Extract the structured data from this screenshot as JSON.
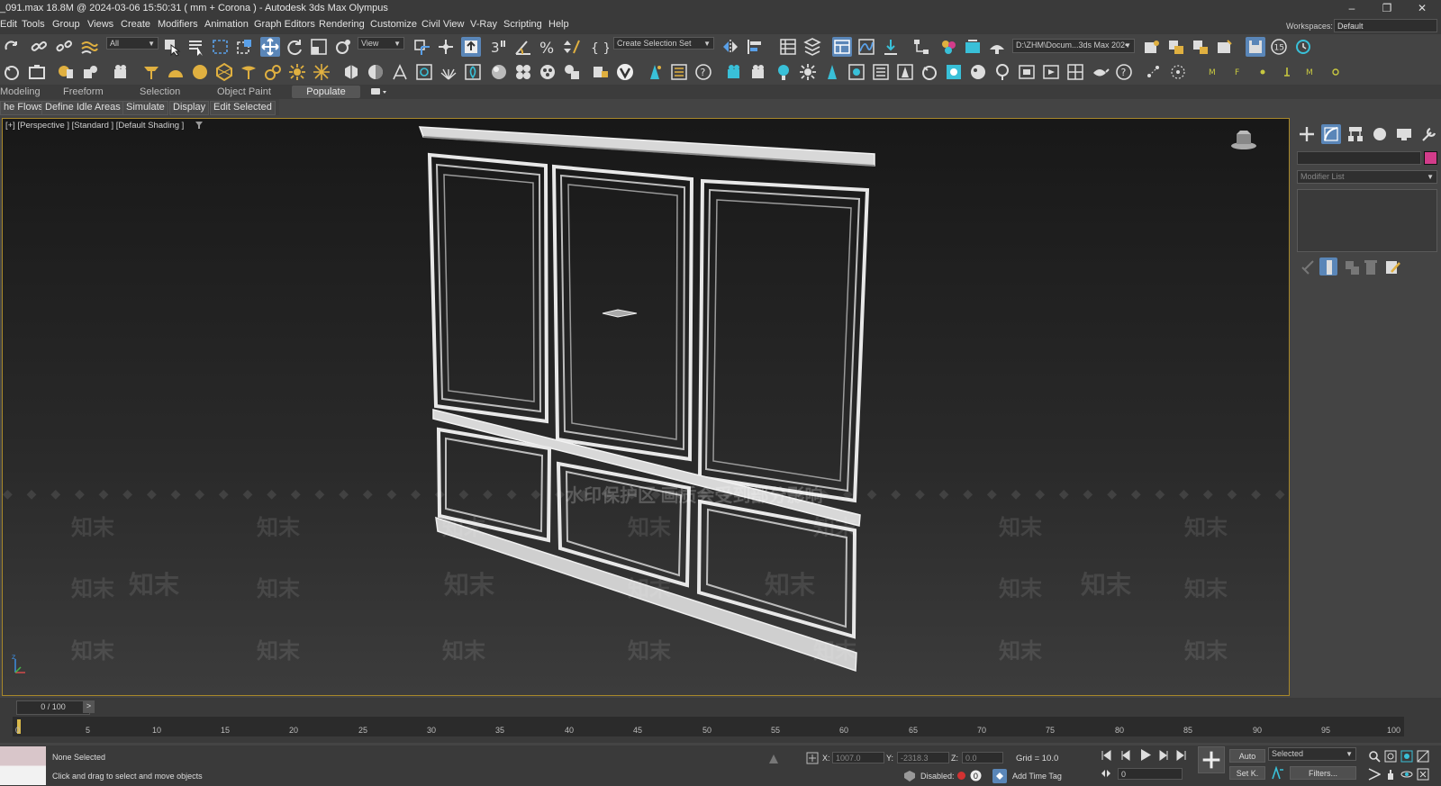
{
  "title": "_091.max  18.8M @ 2024-03-06 15:50:31  ( mm + Corona ) - Autodesk 3ds Max Olympus",
  "menu": [
    "Edit",
    "Tools",
    "Group",
    "Views",
    "Create",
    "Modifiers",
    "Animation",
    "Graph Editors",
    "Rendering",
    "Customize",
    "Civil View",
    "V-Ray",
    "Scripting",
    "Help"
  ],
  "workspace": {
    "label": "Workspaces:",
    "value": "Default"
  },
  "toolbar": {
    "filter": "All",
    "ref_coord": "View",
    "selection_set": "Create Selection Set",
    "project_path": "D:\\ZHM\\Docum...3ds Max 202•"
  },
  "ribbon": {
    "tabs": [
      "Modeling",
      "Freeform",
      "Selection",
      "Object Paint",
      "Populate"
    ],
    "commands": [
      "he Flows",
      "Define Idle Areas",
      "Simulate",
      "Display",
      "Edit Selected"
    ]
  },
  "viewport": {
    "label": "[+] [Perspective ] [Standard ] [Default Shading ]"
  },
  "cmd_panel": {
    "modifier_list": "Modifier List",
    "object_color": "#d23c8a"
  },
  "timeline": {
    "slider": "0 / 100",
    "next": ">",
    "ticks": [
      "0",
      "5",
      "10",
      "15",
      "20",
      "25",
      "30",
      "35",
      "40",
      "45",
      "50",
      "55",
      "60",
      "65",
      "70",
      "75",
      "80",
      "85",
      "90",
      "95",
      "100"
    ]
  },
  "status": {
    "selected": "None Selected",
    "prompt": "Click and drag to select and move objects",
    "x_label": "X:",
    "x_value": "1007.0",
    "y_label": "Y:",
    "y_value": "-2318.3",
    "z_label": "Z:",
    "z_value": "0.0",
    "grid": "Grid = 10.0",
    "disabled": "Disabled:",
    "add_time_tag": "Add Time Tag",
    "auto": "Auto",
    "selected_mode": "Selected",
    "setkey": "Set K.",
    "filters": "Filters...",
    "frame": "0"
  },
  "watermark": {
    "text": "知末",
    "banner": "水印保护区  画质会受到部分影响"
  }
}
